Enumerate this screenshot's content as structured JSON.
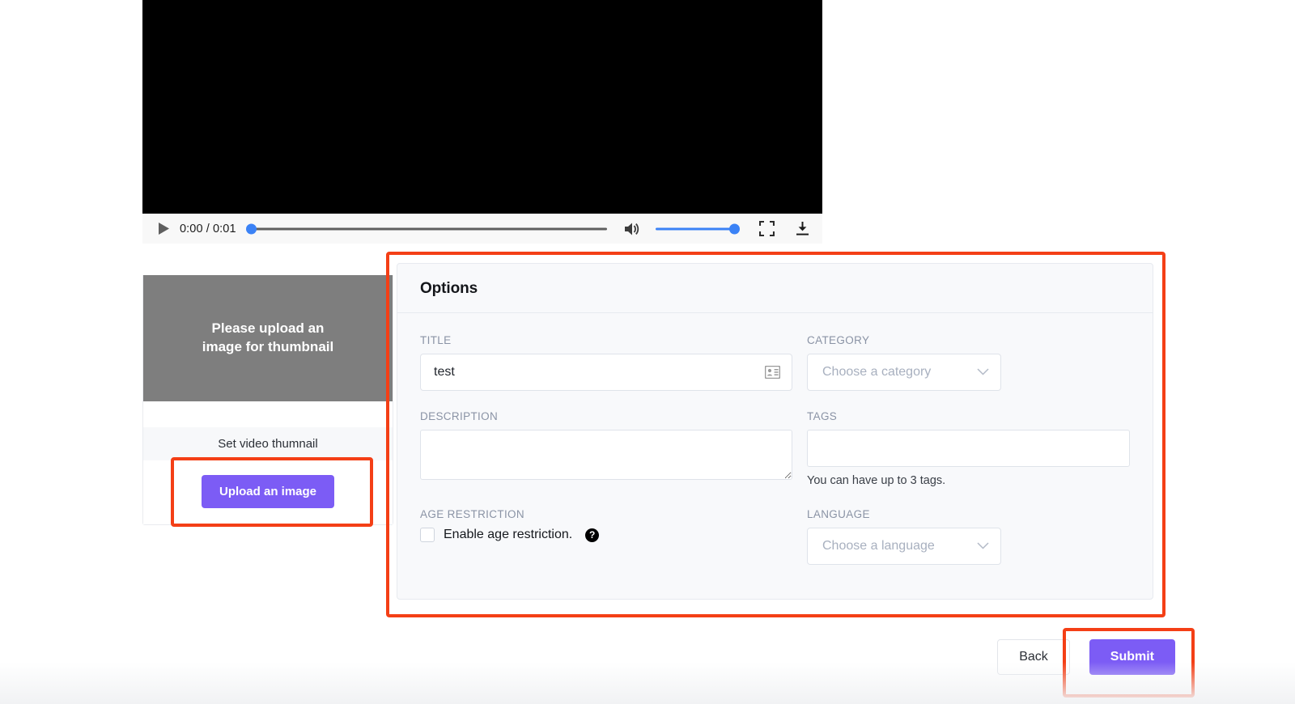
{
  "video_player": {
    "play_icon": "play-icon",
    "time_display": "0:00 / 0:01",
    "current_time": "0:00",
    "duration": "0:01",
    "progress_percent": 0,
    "volume_percent": 100,
    "volume_icon": "volume-high-icon",
    "fullscreen_icon": "fullscreen-icon",
    "download_icon": "download-icon",
    "accent_color": "#3b82f6"
  },
  "thumbnail_card": {
    "placeholder_text": "Please upload an image for thumbnail",
    "caption": "Set video thumnail",
    "upload_button_label": "Upload an image",
    "placeholder_bg": "#7e7e7e",
    "button_color": "#7c5cf5"
  },
  "options": {
    "header_title": "Options",
    "title": {
      "label": "TITLE",
      "value": "test",
      "placeholder": "",
      "icon": "contact-card-icon"
    },
    "category": {
      "label": "CATEGORY",
      "placeholder": "Choose a category",
      "selected": "",
      "chevron_icon": "chevron-down-icon"
    },
    "description": {
      "label": "DESCRIPTION",
      "value": "",
      "placeholder": ""
    },
    "tags": {
      "label": "TAGS",
      "value": "",
      "placeholder": "",
      "hint": "You can have up to 3 tags."
    },
    "age_restriction": {
      "label": "AGE RESTRICTION",
      "checkbox_label": "Enable age restriction.",
      "checked": false,
      "help_icon": "question-mark-icon",
      "help_glyph": "?"
    },
    "language": {
      "label": "LANGUAGE",
      "placeholder": "Choose a language",
      "selected": "",
      "chevron_icon": "chevron-down-icon"
    }
  },
  "footer": {
    "back_label": "Back",
    "submit_label": "Submit"
  },
  "annotations": {
    "color": "#f43f16",
    "boxes": [
      "options-panel",
      "upload-image-button",
      "submit-button"
    ]
  }
}
